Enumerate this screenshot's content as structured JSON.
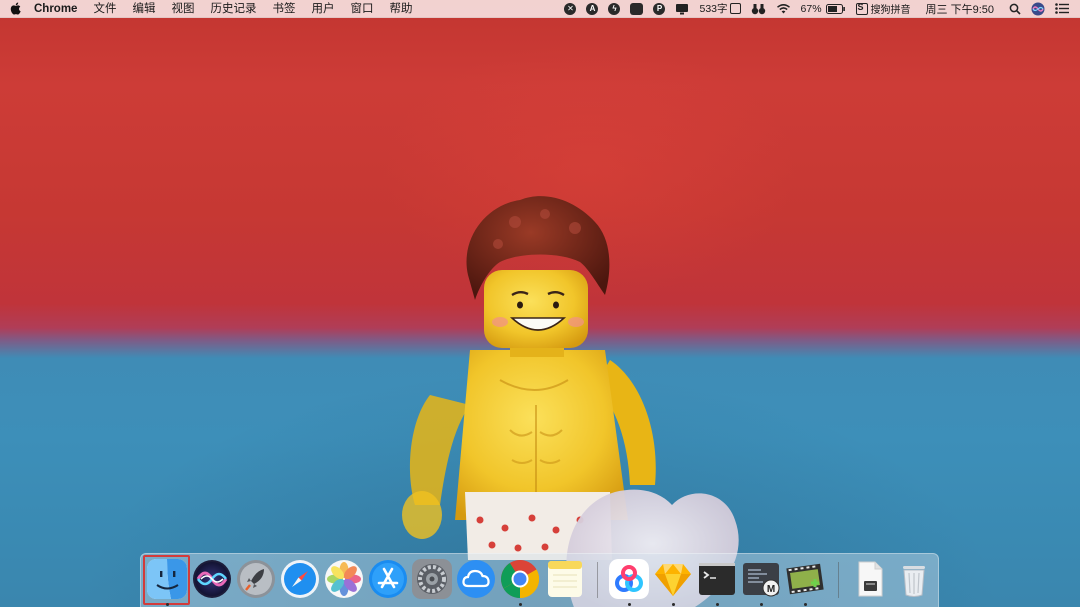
{
  "menubar": {
    "apple_icon": "apple-logo-icon",
    "app_name": "Chrome",
    "menus": [
      "文件",
      "编辑",
      "视图",
      "历史记录",
      "书签",
      "用户",
      "窗口",
      "帮助"
    ],
    "status": {
      "word_count": "533字",
      "wifi_icon": "wifi-icon",
      "battery_percent": "67%",
      "input_method": "搜狗拼音",
      "datetime": "周三 下午9:50"
    }
  },
  "dock": {
    "apps": [
      {
        "name": "Finder",
        "icon": "finder-icon",
        "running": true,
        "highlighted": true
      },
      {
        "name": "Siri",
        "icon": "siri-icon",
        "running": false
      },
      {
        "name": "Launchpad",
        "icon": "launchpad-rocket-icon",
        "running": false
      },
      {
        "name": "Safari",
        "icon": "safari-compass-icon",
        "running": false
      },
      {
        "name": "Photos",
        "icon": "photos-icon",
        "running": false
      },
      {
        "name": "App Store",
        "icon": "app-store-icon",
        "running": false
      },
      {
        "name": "System Preferences",
        "icon": "system-preferences-gear-icon",
        "running": false
      },
      {
        "name": "iCloud",
        "icon": "cloud-icon",
        "running": false
      },
      {
        "name": "Chrome",
        "icon": "chrome-icon",
        "running": true
      },
      {
        "name": "Notes",
        "icon": "notes-icon",
        "running": false
      },
      {
        "name": "Baidu Netdisk",
        "icon": "baidu-netdisk-icon",
        "running": true
      },
      {
        "name": "Sketch",
        "icon": "sketch-diamond-icon",
        "running": true
      },
      {
        "name": "Terminal",
        "icon": "terminal-icon",
        "running": true
      },
      {
        "name": "MWeb",
        "icon": "mweb-editor-icon",
        "running": true
      },
      {
        "name": "Video Editor",
        "icon": "film-strip-icon",
        "running": true
      },
      {
        "name": "Documents",
        "icon": "document-folder-icon",
        "running": false
      },
      {
        "name": "Trash",
        "icon": "trash-icon",
        "running": false
      }
    ]
  },
  "colors": {
    "wall_red": "#c63833",
    "wall_blue": "#3d8fb9",
    "lego_yellow": "#f3c623",
    "hair_brown": "#6b2316",
    "highlight": "#d23b3b"
  }
}
